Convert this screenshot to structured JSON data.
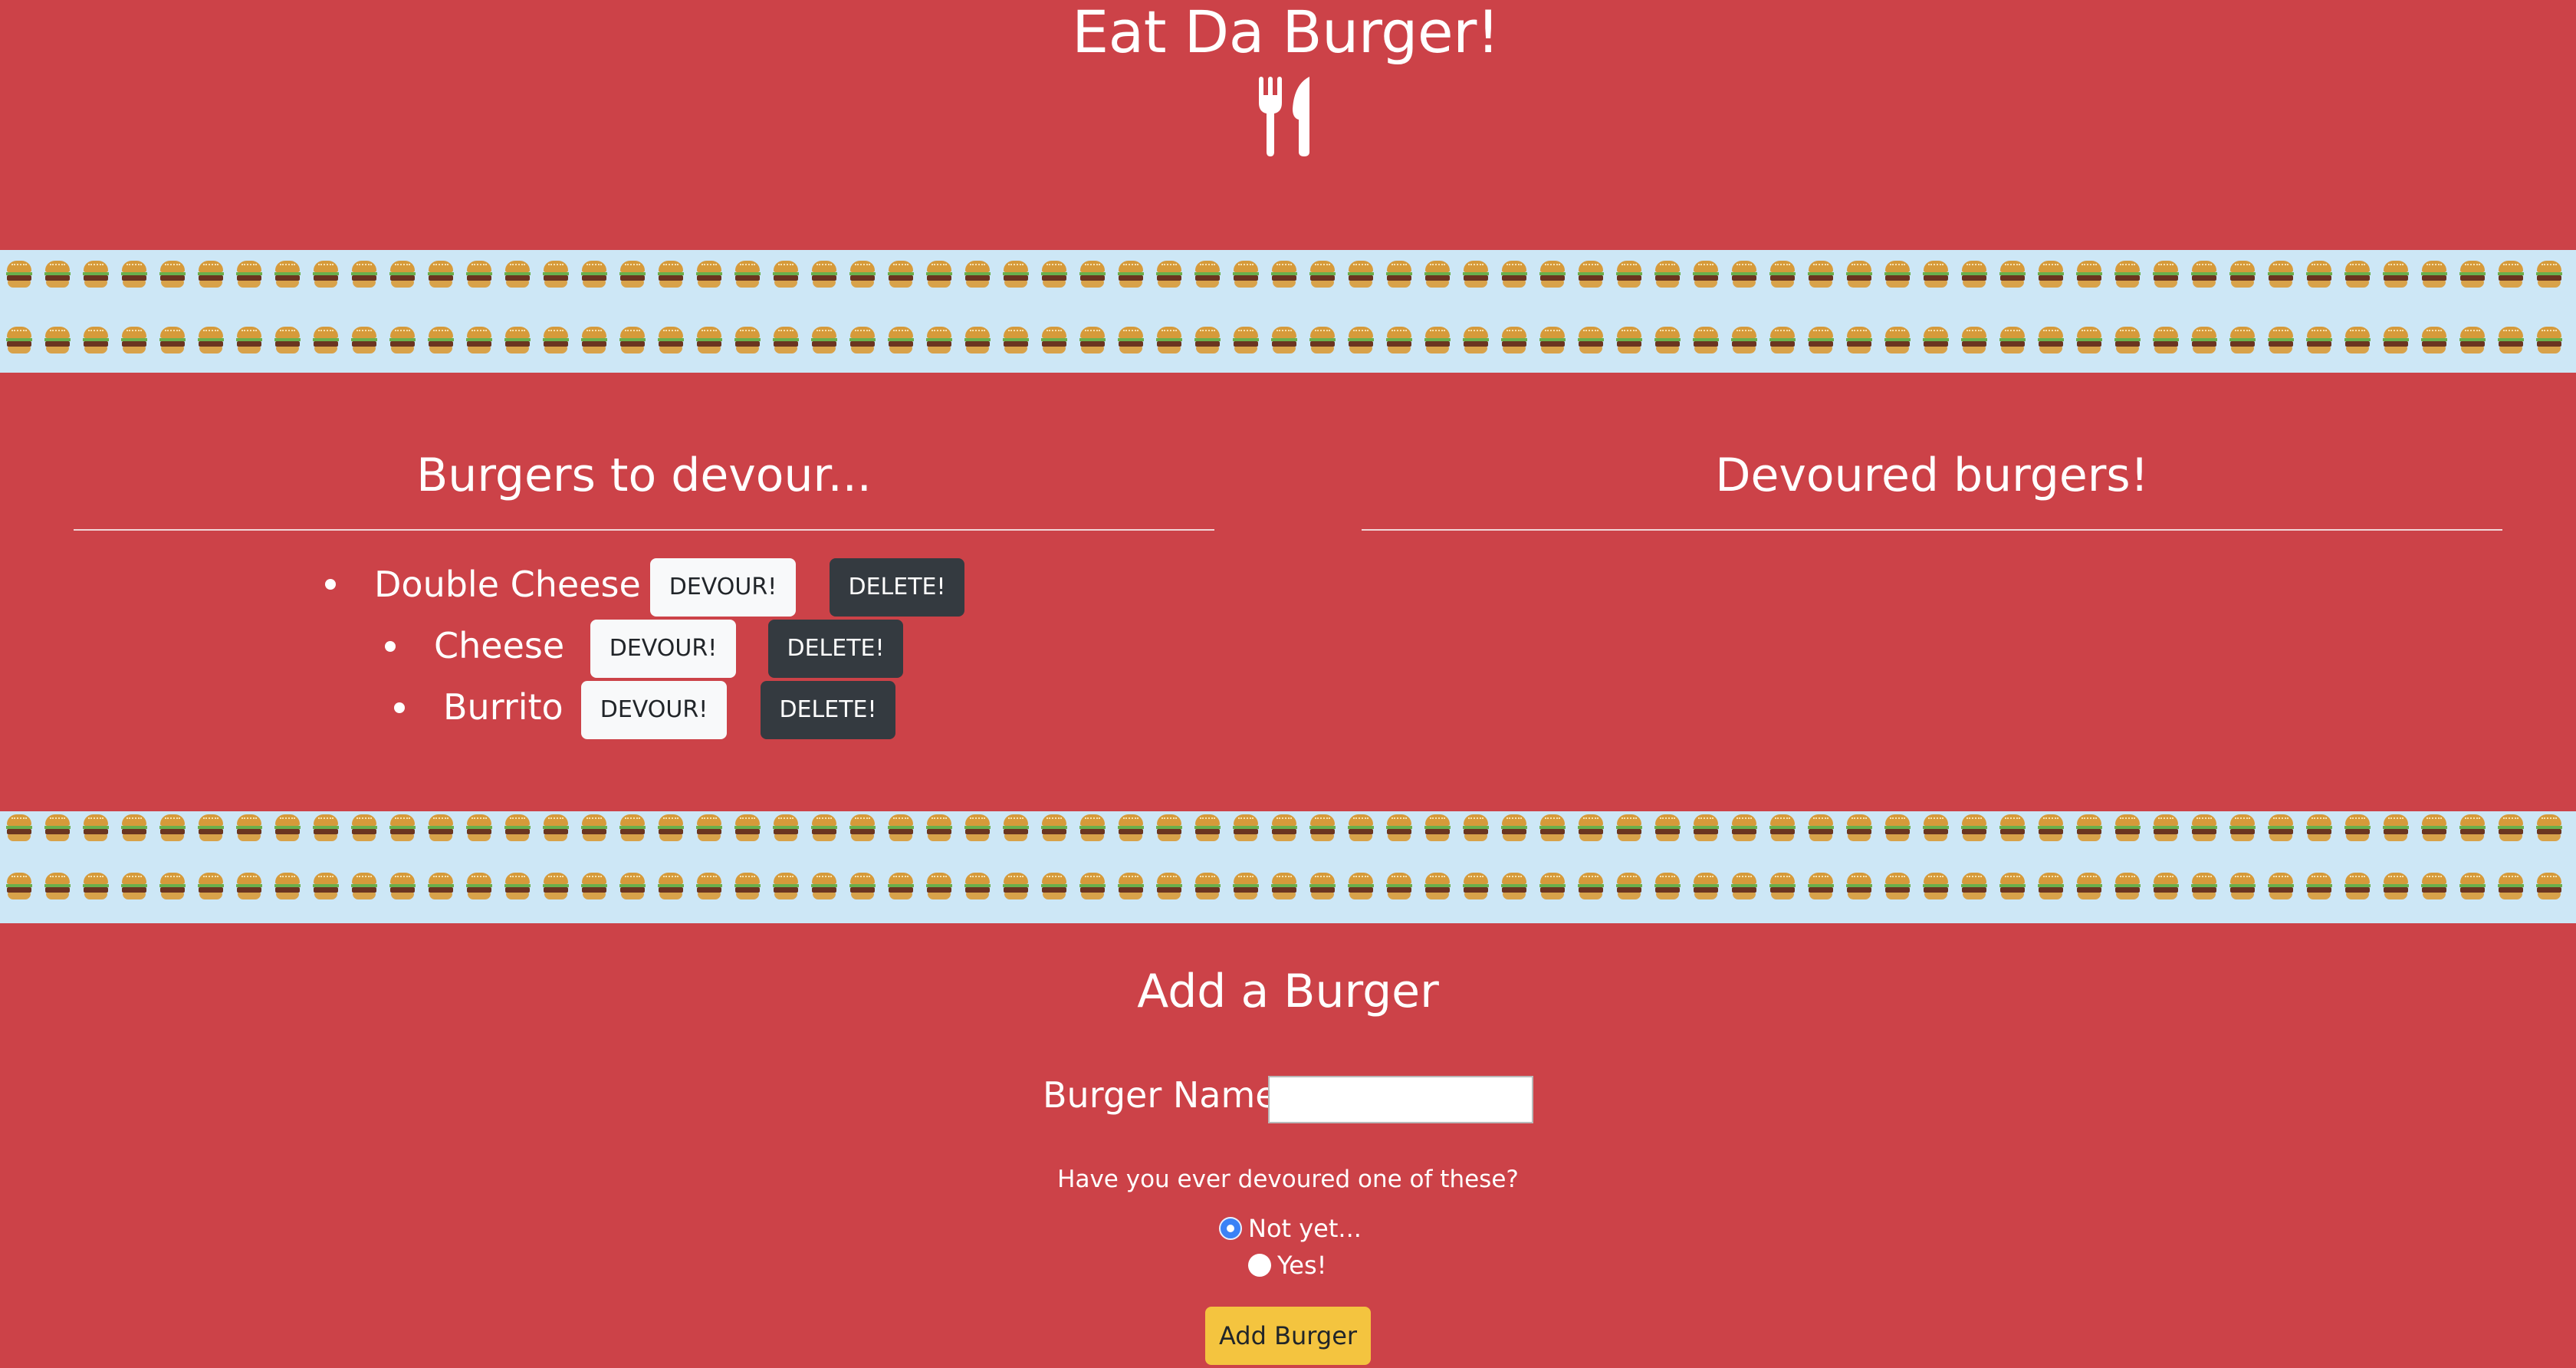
{
  "header": {
    "title": "Eat Da Burger!",
    "icon": "utensils-icon"
  },
  "decoration": {
    "strip_icon": "burger-emoji-icon",
    "strip_background": "#cde7f6"
  },
  "to_devour": {
    "title": "Burgers to devour...",
    "items": [
      {
        "name": "Double Cheese",
        "devour_label": "DEVOUR!",
        "delete_label": "DELETE!"
      },
      {
        "name": "Cheese",
        "devour_label": "DEVOUR!",
        "delete_label": "DELETE!"
      },
      {
        "name": "Burrito",
        "devour_label": "DEVOUR!",
        "delete_label": "DELETE!"
      }
    ]
  },
  "devoured": {
    "title": "Devoured burgers!",
    "items": []
  },
  "add_form": {
    "title": "Add a Burger",
    "name_label": "Burger Name:",
    "name_value": "",
    "question": "Have you ever devoured one of these?",
    "options": [
      {
        "label": "Not yet...",
        "checked": true
      },
      {
        "label": "Yes!",
        "checked": false
      }
    ],
    "submit_label": "Add Burger"
  },
  "colors": {
    "background": "#cc4248",
    "devour_button": "#f8f9fa",
    "delete_button": "#343a40",
    "submit_button": "#f4c43f"
  }
}
